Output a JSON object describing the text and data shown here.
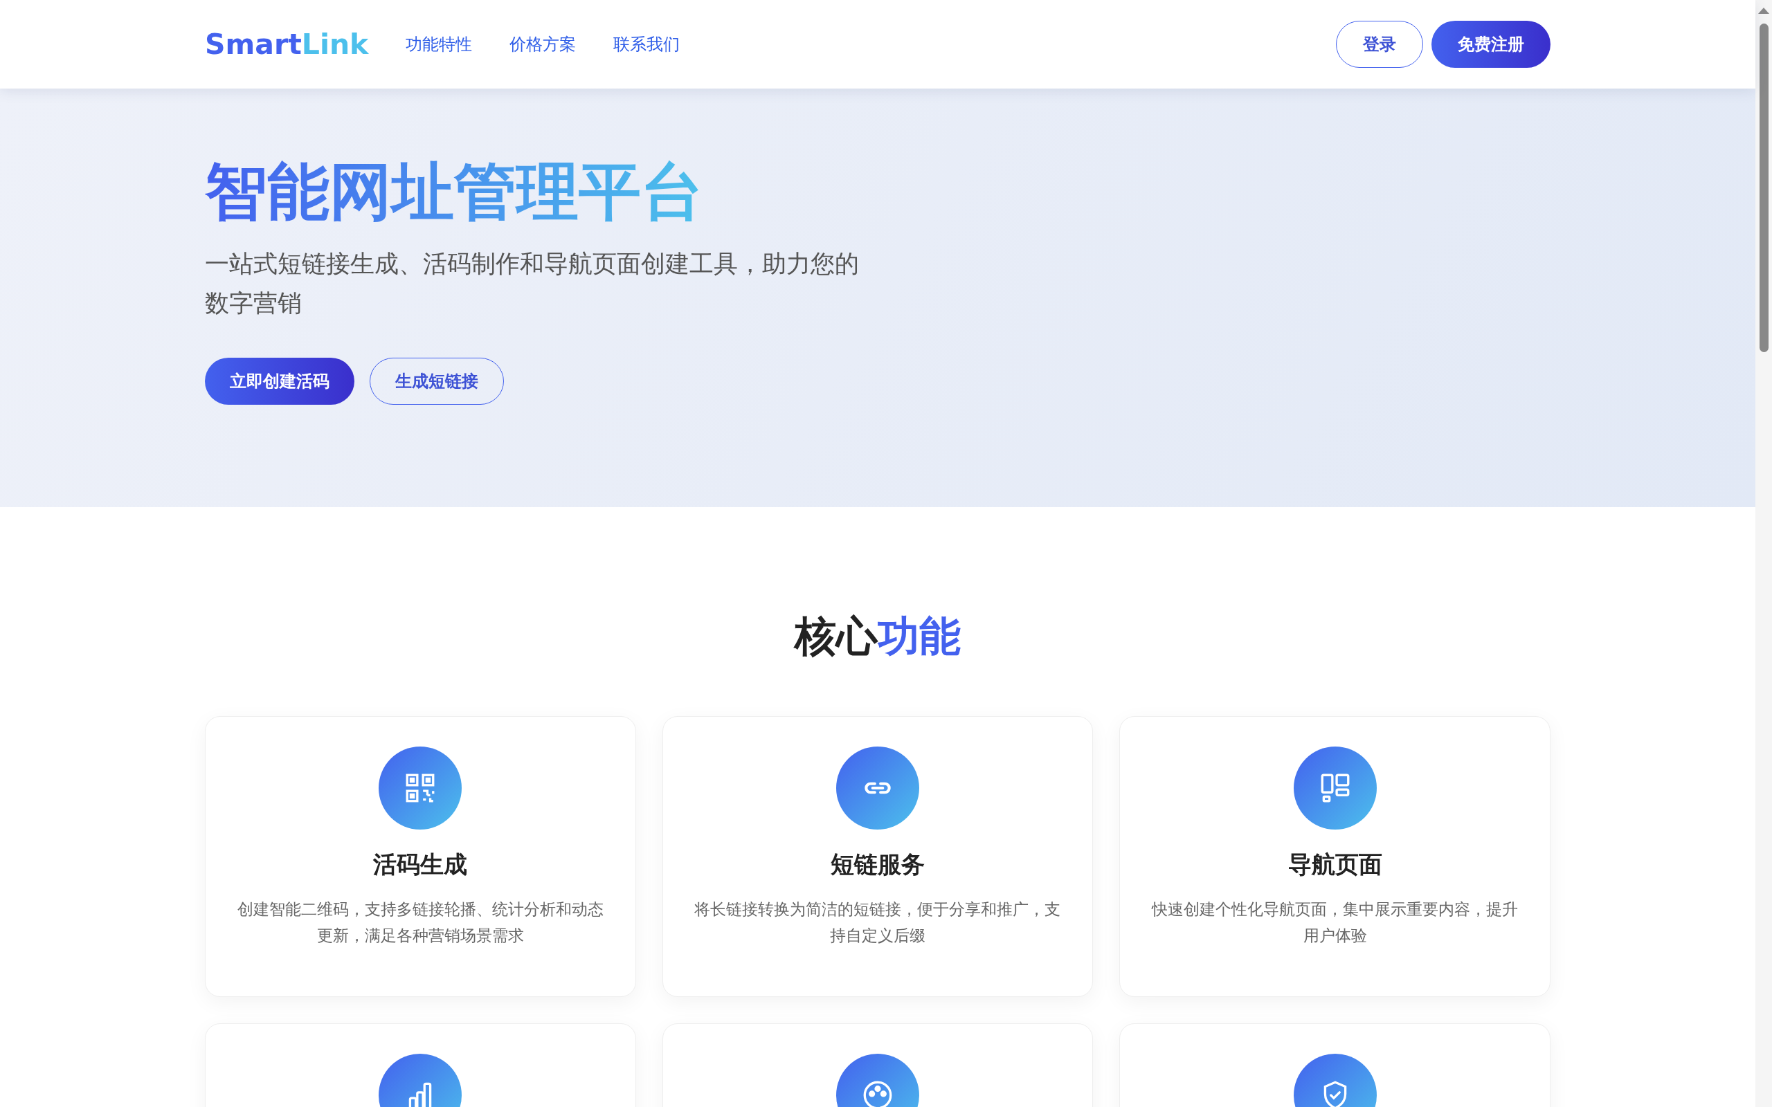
{
  "nav": {
    "logo_main": "Smart",
    "logo_accent": "Link",
    "links": [
      {
        "label": "功能特性"
      },
      {
        "label": "价格方案"
      },
      {
        "label": "联系我们"
      }
    ],
    "login": "登录",
    "register": "免费注册"
  },
  "hero": {
    "title": "智能网址管理平台",
    "subtitle": "一站式短链接生成、活码制作和导航页面创建工具，助力您的数字营销",
    "buttons": [
      {
        "label": "立即创建活码",
        "kind": "primary"
      },
      {
        "label": "生成短链接",
        "kind": "outline"
      }
    ]
  },
  "features": {
    "title": "核心",
    "title_highlight": "功能",
    "cards": [
      {
        "kind": "qr",
        "title": "活码生成",
        "description": "创建智能二维码，支持多链接轮播、统计分析和动态更新，满足各种营销场景需求"
      },
      {
        "kind": "link",
        "title": "短链服务",
        "description": "将长链接转换为简洁的短链接，便于分享和推广，支持自定义后缀"
      },
      {
        "kind": "layout",
        "title": "导航页面",
        "description": "快速创建个性化导航页面，集中展示重要内容，提升用户体验"
      },
      {
        "kind": "chart"
      },
      {
        "kind": "palette"
      },
      {
        "kind": "shield"
      }
    ]
  }
}
